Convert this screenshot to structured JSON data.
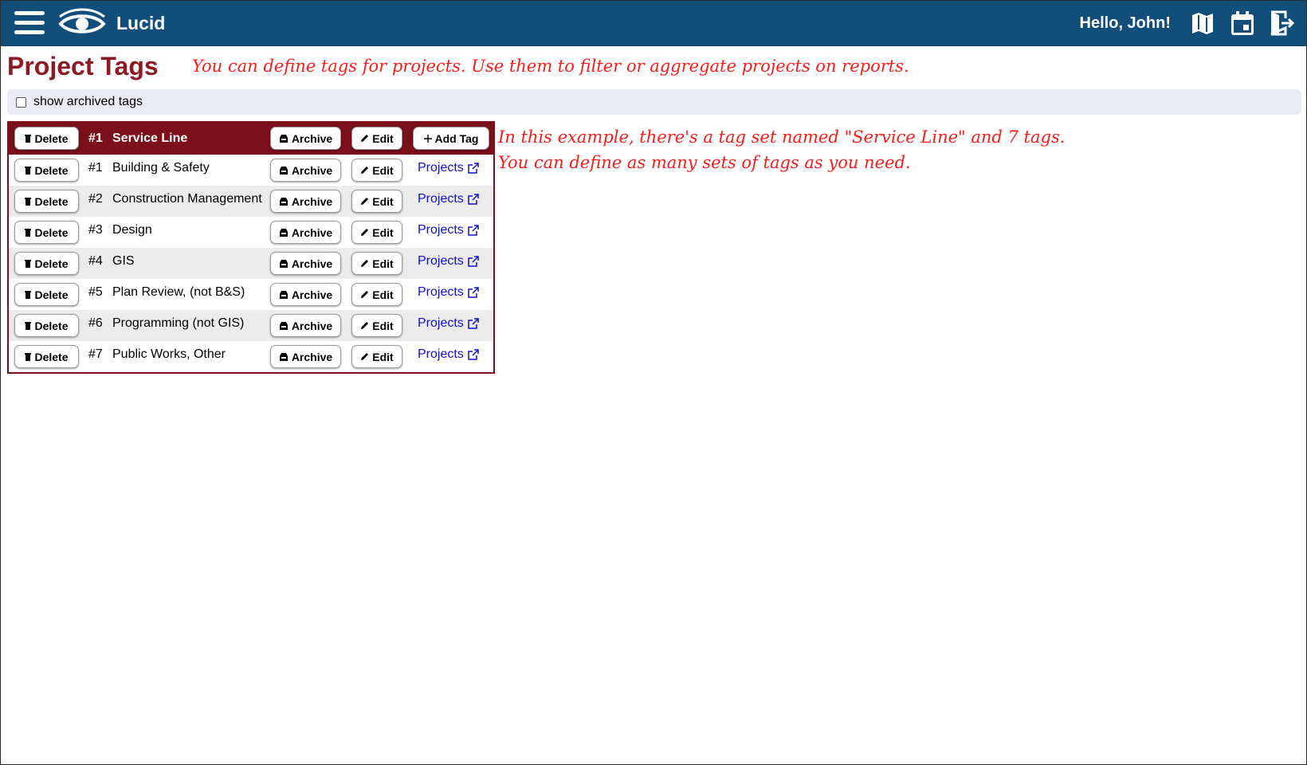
{
  "app": {
    "brand": "Lucid",
    "greeting": "Hello, John!"
  },
  "header_icons": [
    "map-icon",
    "calendar-icon",
    "logout-icon"
  ],
  "page": {
    "title": "Project Tags",
    "intro_note": "You can define tags for projects. Use them to filter or aggregate projects on reports."
  },
  "filter": {
    "show_archived_label": "show archived tags",
    "show_archived_checked": false
  },
  "tag_set": {
    "num": "#1",
    "name": "Service Line",
    "delete_label": "Delete",
    "archive_label": "Archive",
    "edit_label": "Edit",
    "add_tag_label": "Add Tag"
  },
  "tags": [
    {
      "num": "#1",
      "name": "Building & Safety",
      "delete_label": "Delete",
      "archive_label": "Archive",
      "edit_label": "Edit",
      "projects_label": "Projects"
    },
    {
      "num": "#2",
      "name": "Construction Management",
      "delete_label": "Delete",
      "archive_label": "Archive",
      "edit_label": "Edit",
      "projects_label": "Projects"
    },
    {
      "num": "#3",
      "name": "Design",
      "delete_label": "Delete",
      "archive_label": "Archive",
      "edit_label": "Edit",
      "projects_label": "Projects"
    },
    {
      "num": "#4",
      "name": "GIS",
      "delete_label": "Delete",
      "archive_label": "Archive",
      "edit_label": "Edit",
      "projects_label": "Projects"
    },
    {
      "num": "#5",
      "name": "Plan Review, (not B&S)",
      "delete_label": "Delete",
      "archive_label": "Archive",
      "edit_label": "Edit",
      "projects_label": "Projects"
    },
    {
      "num": "#6",
      "name": "Programming (not GIS)",
      "delete_label": "Delete",
      "archive_label": "Archive",
      "edit_label": "Edit",
      "projects_label": "Projects"
    },
    {
      "num": "#7",
      "name": "Public Works, Other",
      "delete_label": "Delete",
      "archive_label": "Archive",
      "edit_label": "Edit",
      "projects_label": "Projects"
    }
  ],
  "annotations": {
    "example_line1": "In this example, there's a tag set named \"Service Line\" and 7 tags.",
    "example_line2": "You can define as many sets of tags as you need."
  },
  "colors": {
    "topbar": "#114e7a",
    "title": "#8b1a24",
    "table_header": "#7b0f1a",
    "annotation": "#ff1a1a",
    "link": "#1010d0",
    "filter_bg": "#ebebf8"
  }
}
